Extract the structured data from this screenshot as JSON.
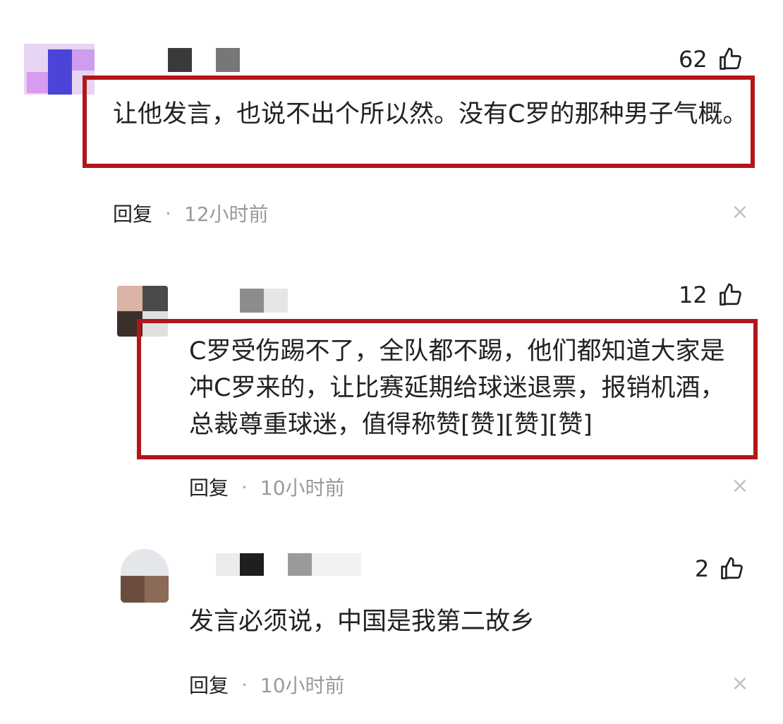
{
  "comments": [
    {
      "likes": "62",
      "text": "让他发言，也说不出个所以然。没有C罗的那种男子气概。",
      "reply_label": "回复",
      "separator": "·",
      "time": "12小时前",
      "close_glyph": "×"
    },
    {
      "likes": "12",
      "text": "C罗受伤踢不了，全队都不踢，他们都知道大家是冲C罗来的，让比赛延期给球迷退票，报销机酒，总裁尊重球迷，值得称赞[赞][赞][赞]",
      "reply_label": "回复",
      "separator": "·",
      "time": "10小时前",
      "close_glyph": "×"
    },
    {
      "likes": "2",
      "text": "发言必须说，中国是我第二故乡",
      "reply_label": "回复",
      "separator": "·",
      "time": "10小时前",
      "close_glyph": "×"
    }
  ],
  "icons": {
    "like": "thumbs-up-icon",
    "close": "close-icon"
  },
  "colors": {
    "highlight_border": "#b3151b",
    "meta_time": "#9a9a9a",
    "close": "#c2c2c2"
  }
}
